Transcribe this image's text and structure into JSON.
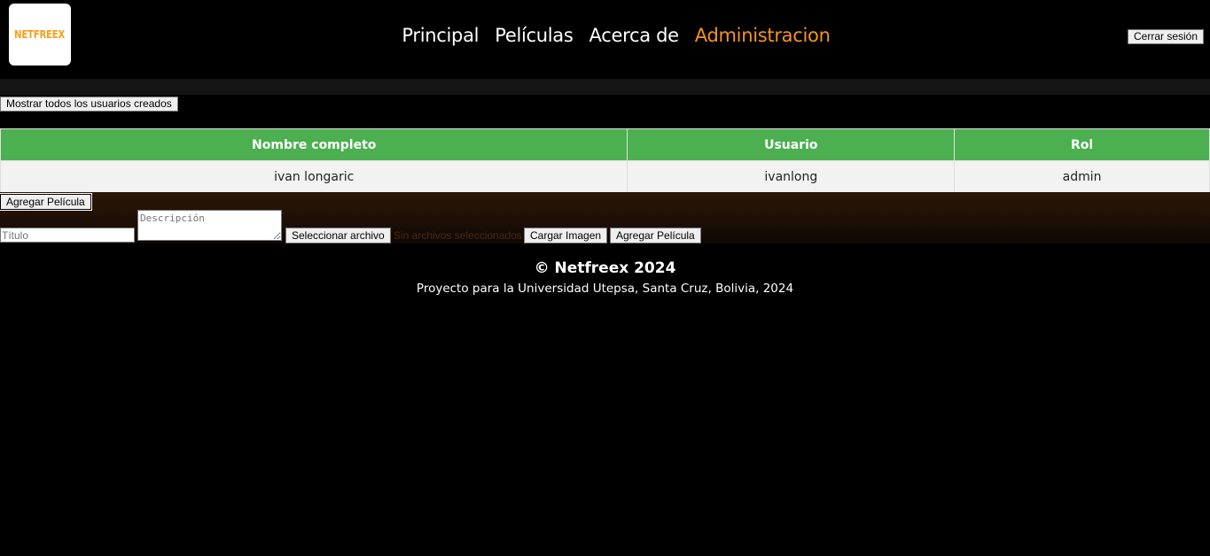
{
  "header": {
    "logo_text": "NETFREEX",
    "nav": [
      {
        "label": "Principal",
        "active": false
      },
      {
        "label": "Películas",
        "active": false
      },
      {
        "label": "Acerca de",
        "active": false
      },
      {
        "label": "Administracion",
        "active": true
      }
    ],
    "logout_label": "Cerrar sesión"
  },
  "admin": {
    "show_users_label": "Mostrar todos los usuarios creados",
    "table": {
      "headers": [
        "Nombre completo",
        "Usuario",
        "Rol"
      ],
      "rows": [
        [
          "ivan longaric",
          "ivanlong",
          "admin"
        ]
      ]
    }
  },
  "movie_form": {
    "toggle_label": "Agregar Película",
    "title_placeholder": "Título",
    "description_placeholder": "Descripción",
    "file_button_label": "Seleccionar archivo",
    "file_status": "Sin archivos seleccionados",
    "upload_label": "Cargar Imagen",
    "submit_label": "Agregar Película"
  },
  "footer": {
    "copyright": "© Netfreex 2024",
    "subtitle": "Proyecto para la Universidad Utepsa, Santa Cruz, Bolivia, 2024"
  },
  "colors": {
    "accent": "#f7941d",
    "table_header": "#4caf50",
    "background": "#000000"
  }
}
